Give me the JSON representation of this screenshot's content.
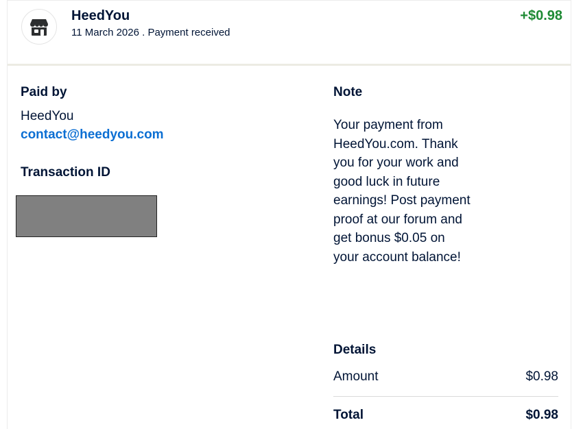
{
  "transaction": {
    "merchant_name": "HeedYou",
    "date_status": "11 March 2026 . Payment received",
    "amount": "+$0.98",
    "icon": "store-icon",
    "amount_color": "#1e8a34"
  },
  "paid_by": {
    "title": "Paid by",
    "name": "HeedYou",
    "email": "contact@heedyou.com"
  },
  "transaction_id": {
    "title": "Transaction ID",
    "value_redacted": true
  },
  "note": {
    "title": "Note",
    "text": "Your payment from HeedYou.com. Thank you for your work and good luck in future earnings! Post payment proof at our forum and get bonus $0.05 on your account balance!"
  },
  "details": {
    "title": "Details",
    "rows": [
      {
        "label": "Amount",
        "value": "$0.98"
      }
    ],
    "total": {
      "label": "Total",
      "value": "$0.98"
    }
  },
  "colors": {
    "text": "#001435",
    "link": "#0c6fd3",
    "positive": "#1e8a34"
  }
}
